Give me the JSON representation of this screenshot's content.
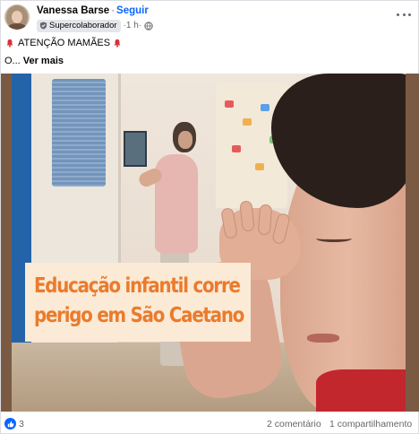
{
  "post": {
    "author_name": "Vanessa Barse",
    "separator": "·",
    "follow_label": "Seguir",
    "badge_label": "Supercolaborador",
    "time": "1 h",
    "text_line1": "ATENÇÃO  MAMÃES",
    "text_line2": "O...",
    "see_more_label": "Ver mais"
  },
  "media": {
    "caption_line1": "Educação infantil corre",
    "caption_line2": "perigo em São Caetano",
    "caption_color": "#ea7b2c"
  },
  "footer": {
    "reaction_count": "3",
    "comments_label": "2 comentário",
    "shares_label": "1 compartilhamento"
  },
  "icons": {
    "reaction": "like-icon",
    "emoji": "bell-icon",
    "privacy": "globe-icon",
    "badge": "badge-icon",
    "menu": "more-icon"
  },
  "colors": {
    "link": "#0866ff",
    "secondary_text": "#65676b",
    "bell": "#d9303a"
  }
}
